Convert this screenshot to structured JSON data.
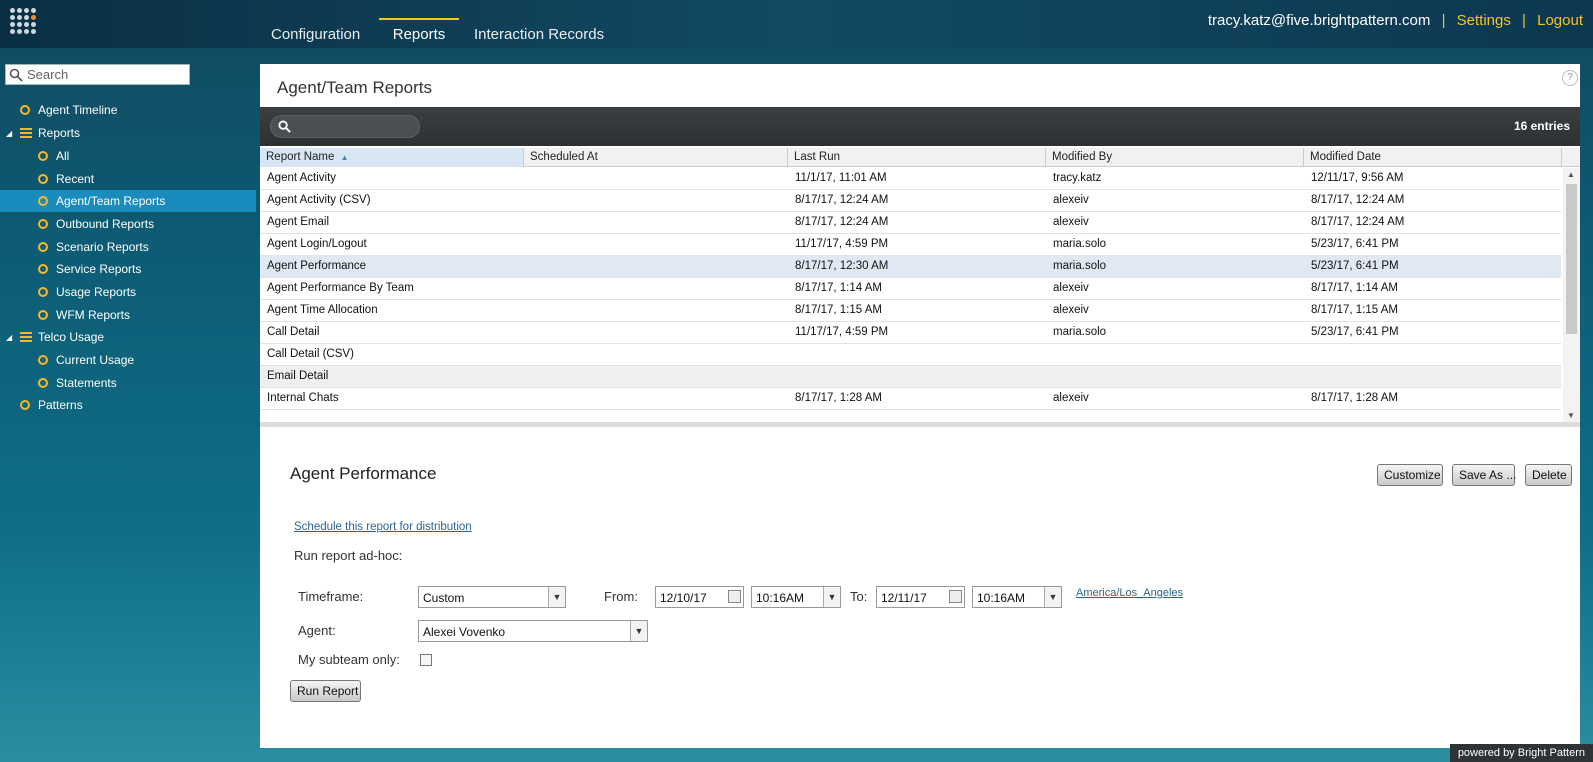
{
  "topbar": {
    "tabs": [
      {
        "label": "Configuration"
      },
      {
        "label": "Reports"
      },
      {
        "label": "Interaction Records"
      }
    ],
    "user": "tracy.katz@five.brightpattern.com",
    "sep": "|",
    "settings": "Settings",
    "logout": "Logout"
  },
  "sidebar": {
    "search_placeholder": "Search",
    "items": [
      {
        "label": "Agent Timeline"
      },
      {
        "label": "Reports"
      },
      {
        "label": "All"
      },
      {
        "label": "Recent"
      },
      {
        "label": "Agent/Team Reports"
      },
      {
        "label": "Outbound Reports"
      },
      {
        "label": "Scenario Reports"
      },
      {
        "label": "Service Reports"
      },
      {
        "label": "Usage Reports"
      },
      {
        "label": "WFM Reports"
      },
      {
        "label": "Telco Usage"
      },
      {
        "label": "Current Usage"
      },
      {
        "label": "Statements"
      },
      {
        "label": "Patterns"
      }
    ]
  },
  "main": {
    "title": "Agent/Team Reports",
    "help": "?",
    "entries": "16 entries",
    "columns": [
      "Report Name",
      "Scheduled At",
      "Last Run",
      "Modified By",
      "Modified Date"
    ],
    "rows": [
      [
        "Agent Activity",
        "",
        "11/1/17, 11:01 AM",
        "tracy.katz",
        "12/11/17, 9:56 AM"
      ],
      [
        "Agent Activity (CSV)",
        "",
        "8/17/17, 12:24 AM",
        "alexeiv",
        "8/17/17, 12:24 AM"
      ],
      [
        "Agent Email",
        "",
        "8/17/17, 12:24 AM",
        "alexeiv",
        "8/17/17, 12:24 AM"
      ],
      [
        "Agent Login/Logout",
        "",
        "11/17/17, 4:59 PM",
        "maria.solo",
        "5/23/17, 6:41 PM"
      ],
      [
        "Agent Performance",
        "",
        "8/17/17, 12:30 AM",
        "maria.solo",
        "5/23/17, 6:41 PM"
      ],
      [
        "Agent Performance By Team",
        "",
        "8/17/17, 1:14 AM",
        "alexeiv",
        "8/17/17, 1:14 AM"
      ],
      [
        "Agent Time Allocation",
        "",
        "8/17/17, 1:15 AM",
        "alexeiv",
        "8/17/17, 1:15 AM"
      ],
      [
        "Call Detail",
        "",
        "11/17/17, 4:59 PM",
        "maria.solo",
        "5/23/17, 6:41 PM"
      ],
      [
        "Call Detail (CSV)",
        "",
        "",
        "",
        ""
      ],
      [
        "Email Detail",
        "",
        "",
        "",
        ""
      ],
      [
        "Internal Chats",
        "",
        "8/17/17, 1:28 AM",
        "alexeiv",
        "8/17/17, 1:28 AM"
      ]
    ]
  },
  "detail": {
    "title": "Agent Performance",
    "customize": "Customize",
    "save_as": "Save As ...",
    "delete": "Delete",
    "schedule_link": "Schedule this report for distribution",
    "run_adhoc": "Run report ad-hoc:",
    "timeframe_label": "Timeframe:",
    "timeframe_value": "Custom",
    "from_label": "From:",
    "from_date": "12/10/17",
    "from_time": "10:16AM",
    "to_label": "To:",
    "to_date": "12/11/17",
    "to_time": "10:16AM",
    "timezone": "America/Los_Angeles",
    "agent_label": "Agent:",
    "agent_value": "Alexei Vovenko",
    "subteam_label": "My subteam only:",
    "run_report": "Run Report"
  },
  "footer": {
    "powered": "powered by Bright Pattern"
  },
  "colors": {
    "accent": "#f4c12b",
    "selected_nav": "#1a8bbd",
    "selected_row": "#dfe8f3"
  }
}
